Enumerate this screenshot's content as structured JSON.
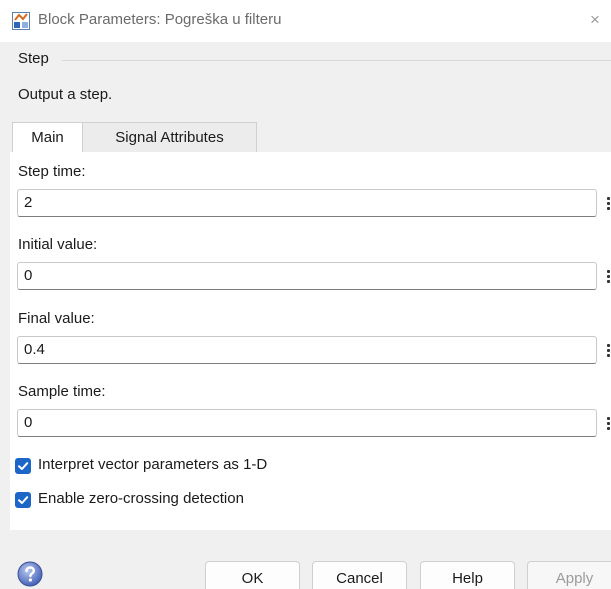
{
  "window": {
    "title": "Block Parameters: Pogreška u filteru",
    "close_glyph": "×"
  },
  "block": {
    "type": "Step",
    "description": "Output a step."
  },
  "tabs": [
    {
      "label": "Main",
      "active": true
    },
    {
      "label": "Signal Attributes",
      "active": false
    }
  ],
  "fields": [
    {
      "label": "Step time:",
      "value": "2"
    },
    {
      "label": "Initial value:",
      "value": "0"
    },
    {
      "label": "Final value:",
      "value": "0.4"
    },
    {
      "label": "Sample time:",
      "value": "0"
    }
  ],
  "checkboxes": [
    {
      "label": "Interpret vector parameters as 1-D",
      "checked": true
    },
    {
      "label": "Enable zero-crossing detection",
      "checked": true
    }
  ],
  "buttons": {
    "ok": "OK",
    "cancel": "Cancel",
    "help": "Help",
    "apply": "Apply"
  },
  "icons": {
    "app": "simulink-block-icon",
    "help": "help-question-icon",
    "field_menu": "vertical-ellipsis-icon"
  },
  "colors": {
    "accent": "#1c66c7",
    "window_bg": "#f0f0f0",
    "panel_bg": "#ffffff"
  }
}
